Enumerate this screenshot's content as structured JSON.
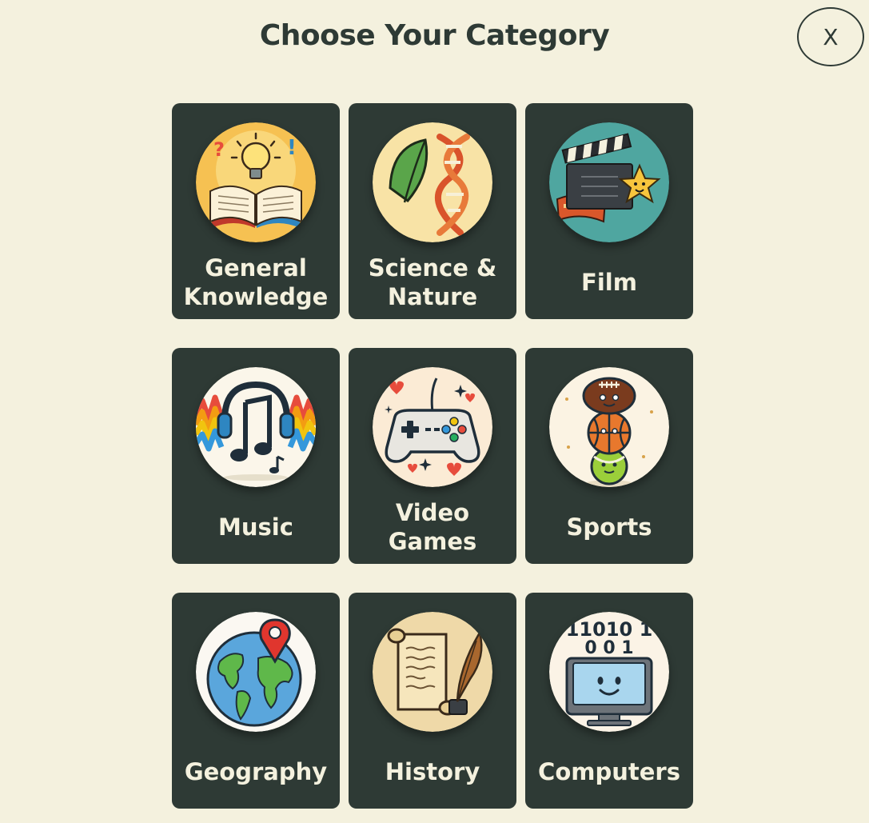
{
  "header": {
    "title": "Choose Your Category",
    "close_label": "X"
  },
  "categories": [
    {
      "label": "General\nKnowledge",
      "icon": "book-lightbulb-icon"
    },
    {
      "label": "Science &\nNature",
      "icon": "leaf-dna-icon"
    },
    {
      "label": "Film",
      "icon": "clapperboard-icon"
    },
    {
      "label": "Music",
      "icon": "headphones-music-note-icon"
    },
    {
      "label": "Video\nGames",
      "icon": "game-controller-icon"
    },
    {
      "label": "Sports",
      "icon": "stacked-balls-icon"
    },
    {
      "label": "Geography",
      "icon": "globe-pin-icon"
    },
    {
      "label": "History",
      "icon": "scroll-quill-icon"
    },
    {
      "label": "Computers",
      "icon": "computer-binary-icon"
    }
  ],
  "icon_text": {
    "binary_line_1": "11010 1",
    "binary_line_2": "0 0 1"
  },
  "colors": {
    "background": "#f4f1de",
    "card": "#2e3a35",
    "text_dark": "#2e3a35",
    "text_light": "#f4f1de"
  }
}
